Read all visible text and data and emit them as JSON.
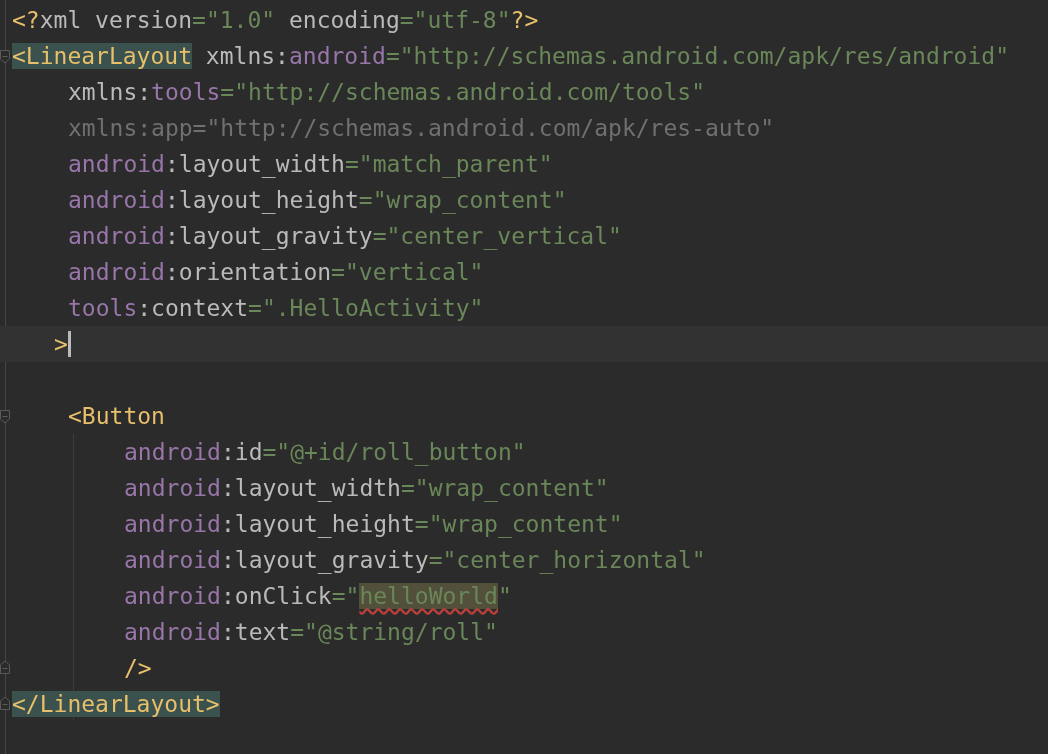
{
  "editor": {
    "lines": [
      {
        "kind": "root",
        "tokens": [
          {
            "kind": "tag",
            "text": "<?"
          },
          {
            "kind": "attr",
            "text": "xml version"
          },
          {
            "kind": "value",
            "text": "=\"1.0\""
          },
          {
            "kind": "attr",
            "text": " encoding"
          },
          {
            "kind": "value",
            "text": "=\"utf-8\""
          },
          {
            "kind": "tag",
            "text": "?>"
          }
        ]
      },
      {
        "kind": "root",
        "fold_start": true,
        "tokens": [
          {
            "kind": "tag-match",
            "text": "<LinearLayout"
          },
          {
            "kind": "attr",
            "text": " xmlns:"
          },
          {
            "kind": "ns",
            "text": "android"
          },
          {
            "kind": "value",
            "text": "=\"http://schemas.android.com/apk/res/android\""
          }
        ]
      },
      {
        "kind": "attribute",
        "tokens": [
          {
            "kind": "attr",
            "text": "xmlns:"
          },
          {
            "kind": "ns",
            "text": "tools"
          },
          {
            "kind": "value",
            "text": "=\"http://schemas.android.com/tools\""
          }
        ]
      },
      {
        "kind": "attribute",
        "tokens": [
          {
            "kind": "muted",
            "text": "xmlns:app=\"http://schemas.android.com/apk/res-auto\""
          }
        ]
      },
      {
        "kind": "attribute",
        "tokens": [
          {
            "kind": "ns",
            "text": "android"
          },
          {
            "kind": "attr",
            "text": ":layout_width"
          },
          {
            "kind": "value",
            "text": "=\"match_parent\""
          }
        ]
      },
      {
        "kind": "attribute",
        "tokens": [
          {
            "kind": "ns",
            "text": "android"
          },
          {
            "kind": "attr",
            "text": ":layout_height"
          },
          {
            "kind": "value",
            "text": "=\"wrap_content\""
          }
        ]
      },
      {
        "kind": "attribute",
        "tokens": [
          {
            "kind": "ns",
            "text": "android"
          },
          {
            "kind": "attr",
            "text": ":layout_gravity"
          },
          {
            "kind": "value",
            "text": "=\"center_vertical\""
          }
        ]
      },
      {
        "kind": "attribute",
        "tokens": [
          {
            "kind": "ns",
            "text": "android"
          },
          {
            "kind": "attr",
            "text": ":orientation"
          },
          {
            "kind": "value",
            "text": "=\"vertical\""
          }
        ]
      },
      {
        "kind": "attribute",
        "tokens": [
          {
            "kind": "ns",
            "text": "tools"
          },
          {
            "kind": "attr",
            "text": ":context"
          },
          {
            "kind": "value",
            "text": "=\".HelloActivity\""
          }
        ]
      },
      {
        "kind": "close",
        "current": true,
        "tokens": [
          {
            "kind": "tag",
            "text": ">"
          }
        ]
      },
      {
        "kind": "blank"
      },
      {
        "kind": "attribute",
        "fold_start": true,
        "tokens": [
          {
            "kind": "tag",
            "text": "<Button"
          }
        ]
      },
      {
        "kind": "nested",
        "tokens": [
          {
            "kind": "ns",
            "text": "android"
          },
          {
            "kind": "attr",
            "text": ":id"
          },
          {
            "kind": "value",
            "text": "=\"@+id/roll_button\""
          }
        ]
      },
      {
        "kind": "nested",
        "tokens": [
          {
            "kind": "ns",
            "text": "android"
          },
          {
            "kind": "attr",
            "text": ":layout_width"
          },
          {
            "kind": "value",
            "text": "=\"wrap_content\""
          }
        ]
      },
      {
        "kind": "nested",
        "tokens": [
          {
            "kind": "ns",
            "text": "android"
          },
          {
            "kind": "attr",
            "text": ":layout_height"
          },
          {
            "kind": "value",
            "text": "=\"wrap_content\""
          }
        ]
      },
      {
        "kind": "nested",
        "tokens": [
          {
            "kind": "ns",
            "text": "android"
          },
          {
            "kind": "attr",
            "text": ":layout_gravity"
          },
          {
            "kind": "value",
            "text": "=\"center_horizontal\""
          }
        ]
      },
      {
        "kind": "nested",
        "tokens": [
          {
            "kind": "ns",
            "text": "android"
          },
          {
            "kind": "attr",
            "text": ":onClick"
          },
          {
            "kind": "value",
            "text": "=\""
          },
          {
            "kind": "value-warning",
            "text": "helloWorld"
          },
          {
            "kind": "value",
            "text": "\""
          }
        ]
      },
      {
        "kind": "nested",
        "tokens": [
          {
            "kind": "ns",
            "text": "android"
          },
          {
            "kind": "attr",
            "text": ":text"
          },
          {
            "kind": "value",
            "text": "=\"@string/roll\""
          }
        ]
      },
      {
        "kind": "nested",
        "fold_end": true,
        "tokens": [
          {
            "kind": "tag",
            "text": "/>"
          }
        ]
      },
      {
        "kind": "root",
        "fold_end": true,
        "tokens": [
          {
            "kind": "tag-match",
            "text": "</LinearLayout>"
          }
        ]
      }
    ]
  }
}
